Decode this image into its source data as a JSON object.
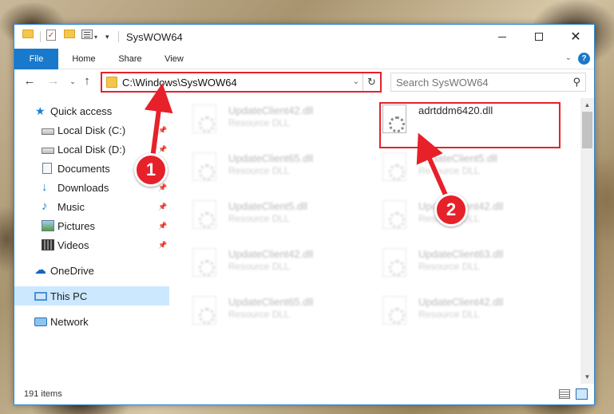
{
  "window": {
    "title": "SysWOW64"
  },
  "ribbon": {
    "tabs": [
      {
        "label": "File"
      },
      {
        "label": "Home"
      },
      {
        "label": "Share"
      },
      {
        "label": "View"
      }
    ],
    "help_icon": "?"
  },
  "nav": {
    "address_path": "C:\\Windows\\SysWOW64",
    "search_placeholder": "Search SysWOW64"
  },
  "sidebar": {
    "items": [
      {
        "label": "Quick access",
        "icon": "star-icon"
      },
      {
        "label": "Local Disk (C:)",
        "icon": "drive-icon",
        "pinned": true
      },
      {
        "label": "Local Disk (D:)",
        "icon": "drive-icon",
        "pinned": true
      },
      {
        "label": "Documents",
        "icon": "documents-icon",
        "pinned": true
      },
      {
        "label": "Downloads",
        "icon": "download-icon",
        "pinned": true
      },
      {
        "label": "Music",
        "icon": "music-icon",
        "pinned": true
      },
      {
        "label": "Pictures",
        "icon": "pictures-icon",
        "pinned": true
      },
      {
        "label": "Videos",
        "icon": "videos-icon",
        "pinned": true
      },
      {
        "label": "OneDrive",
        "icon": "cloud-icon"
      },
      {
        "label": "This PC",
        "icon": "computer-icon",
        "selected": true
      },
      {
        "label": "Network",
        "icon": "network-icon"
      }
    ]
  },
  "files": [
    {
      "name": "UpdateClient42.dll",
      "type": "Resource DLL"
    },
    {
      "name": "adrtddm6420.dll",
      "type": ""
    },
    {
      "name": "UpdateClient65.dll",
      "type": "Resource DLL"
    },
    {
      "name": "UpdateClient5.dll",
      "type": "Resource DLL"
    },
    {
      "name": "UpdateClient5.dll",
      "type": "Resource DLL"
    },
    {
      "name": "UpdateClient42.dll",
      "type": "Resource DLL"
    },
    {
      "name": "UpdateClient42.dll",
      "type": "Resource DLL"
    },
    {
      "name": "UpdateClient63.dll",
      "type": "Resource DLL"
    },
    {
      "name": "UpdateClient65.dll",
      "type": "Resource DLL"
    },
    {
      "name": "UpdateClient42.dll",
      "type": "Resource DLL"
    }
  ],
  "status": {
    "item_count": "191 items"
  },
  "annotations": {
    "step1": "1",
    "step2": "2",
    "color": "#e6212a"
  }
}
